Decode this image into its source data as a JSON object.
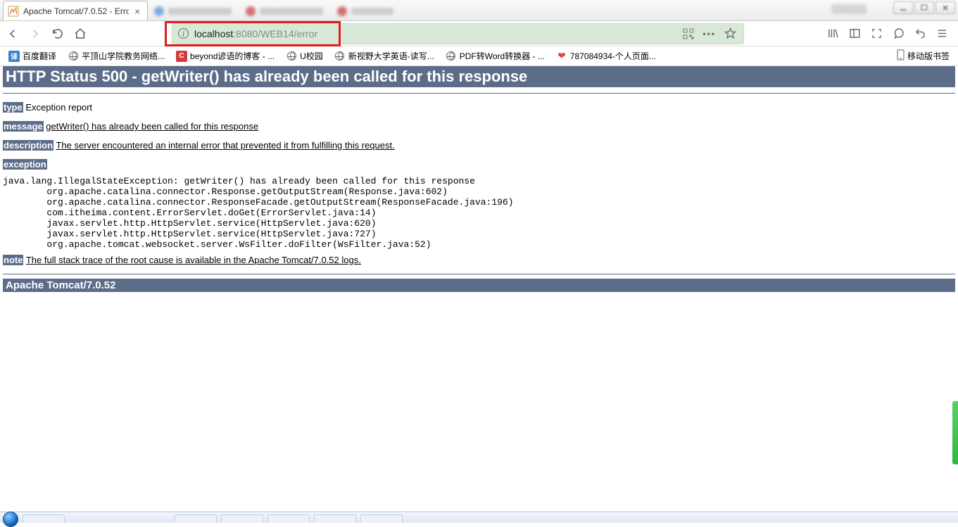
{
  "tabs": {
    "active": {
      "title": "Apache Tomcat/7.0.52 - Erro"
    }
  },
  "url": {
    "host": "localhost",
    "rest": ":8080/WEB14/error"
  },
  "bookmarks": {
    "items": [
      {
        "label": "百度翻译",
        "icon": "baidu-translate"
      },
      {
        "label": "平顶山学院教务网络...",
        "icon": "globe"
      },
      {
        "label": "beyond谚语的博客 - ...",
        "icon": "blog-c"
      },
      {
        "label": "U校园",
        "icon": "globe"
      },
      {
        "label": "新视野大学英语-读写...",
        "icon": "globe"
      },
      {
        "label": "PDF转Word转换器 - ...",
        "icon": "globe"
      },
      {
        "label": "787084934-个人页面...",
        "icon": "heart"
      }
    ],
    "mobile": "移动版书签"
  },
  "error": {
    "status_line": "HTTP Status 500 - getWriter() has already been called for this response",
    "type_label": "type",
    "type_value": "Exception report",
    "message_label": "message",
    "message_value": "getWriter() has already been called for this response",
    "description_label": "description",
    "description_value": "The server encountered an internal error that prevented it from fulfilling this request.",
    "exception_label": "exception",
    "stack": "java.lang.IllegalStateException: getWriter() has already been called for this response\n\torg.apache.catalina.connector.Response.getOutputStream(Response.java:602)\n\torg.apache.catalina.connector.ResponseFacade.getOutputStream(ResponseFacade.java:196)\n\tcom.itheima.content.ErrorServlet.doGet(ErrorServlet.java:14)\n\tjavax.servlet.http.HttpServlet.service(HttpServlet.java:620)\n\tjavax.servlet.http.HttpServlet.service(HttpServlet.java:727)\n\torg.apache.tomcat.websocket.server.WsFilter.doFilter(WsFilter.java:52)",
    "note_label": "note",
    "note_value": "The full stack trace of the root cause is available in the Apache Tomcat/7.0.52 logs.",
    "footer": "Apache Tomcat/7.0.52"
  }
}
